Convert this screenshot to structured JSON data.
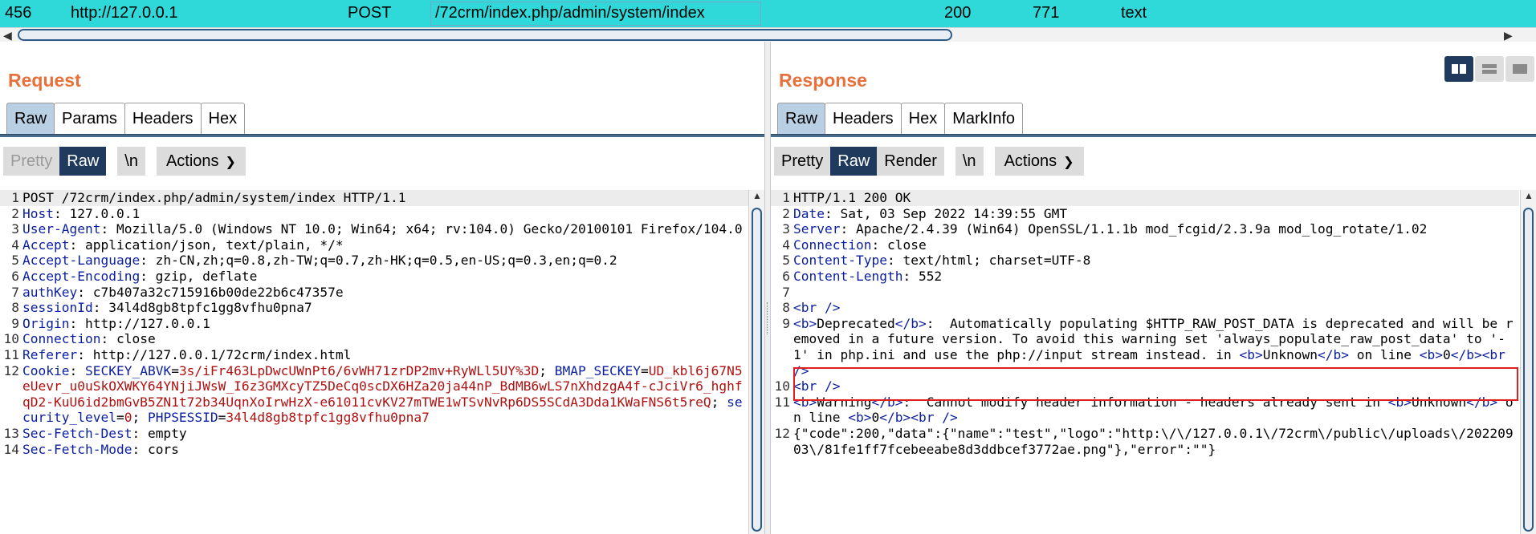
{
  "history_row": {
    "id": "456",
    "host": "http://127.0.0.1",
    "method": "POST",
    "path": "/72crm/index.php/admin/system/index",
    "status": "200",
    "length": "771",
    "mime": "text"
  },
  "request": {
    "title": "Request",
    "tabs": [
      "Raw",
      "Params",
      "Headers",
      "Hex"
    ],
    "toolbar": {
      "pretty": "Pretty",
      "raw": "Raw",
      "newline": "\\n",
      "actions": "Actions"
    },
    "lines": [
      {
        "n": "1",
        "parts": [
          {
            "t": "POST /72crm/index.php/admin/system/index HTTP/1.1",
            "c": ""
          }
        ]
      },
      {
        "n": "2",
        "parts": [
          {
            "t": "Host",
            "c": "hk"
          },
          {
            "t": ": 127.0.0.1",
            "c": ""
          }
        ]
      },
      {
        "n": "3",
        "parts": [
          {
            "t": "User-Agent",
            "c": "hk"
          },
          {
            "t": ": Mozilla/5.0 (Windows NT 10.0; Win64; x64; rv:104.0) Gecko/20100101 Firefox/104.0",
            "c": ""
          }
        ]
      },
      {
        "n": "4",
        "parts": [
          {
            "t": "Accept",
            "c": "hk"
          },
          {
            "t": ": application/json, text/plain, */*",
            "c": ""
          }
        ]
      },
      {
        "n": "5",
        "parts": [
          {
            "t": "Accept-Language",
            "c": "hk"
          },
          {
            "t": ": zh-CN,zh;q=0.8,zh-TW;q=0.7,zh-HK;q=0.5,en-US;q=0.3,en;q=0.2",
            "c": ""
          }
        ]
      },
      {
        "n": "6",
        "parts": [
          {
            "t": "Accept-Encoding",
            "c": "hk"
          },
          {
            "t": ": gzip, deflate",
            "c": ""
          }
        ]
      },
      {
        "n": "7",
        "parts": [
          {
            "t": "authKey",
            "c": "hk"
          },
          {
            "t": ": c7b407a32c715916b00de22b6c47357e",
            "c": ""
          }
        ]
      },
      {
        "n": "8",
        "parts": [
          {
            "t": "sessionId",
            "c": "hk"
          },
          {
            "t": ": 34l4d8gb8tpfc1gg8vfhu0pna7",
            "c": ""
          }
        ]
      },
      {
        "n": "9",
        "parts": [
          {
            "t": "Origin",
            "c": "hk"
          },
          {
            "t": ": http://127.0.0.1",
            "c": ""
          }
        ]
      },
      {
        "n": "10",
        "parts": [
          {
            "t": "Connection",
            "c": "hk"
          },
          {
            "t": ": close",
            "c": ""
          }
        ]
      },
      {
        "n": "11",
        "parts": [
          {
            "t": "Referer",
            "c": "hk"
          },
          {
            "t": ": http://127.0.0.1/72crm/index.html",
            "c": ""
          }
        ]
      },
      {
        "n": "12",
        "parts": [
          {
            "t": "Cookie",
            "c": "hk"
          },
          {
            "t": ": ",
            "c": ""
          },
          {
            "t": "SECKEY_ABVK",
            "c": "cn"
          },
          {
            "t": "=",
            "c": ""
          },
          {
            "t": "3s/iFr463LpDwcUWnPt6/6vWH71zrDP2mv+RyWLl5UY%3D",
            "c": "cv"
          },
          {
            "t": "; ",
            "c": ""
          },
          {
            "t": "BMAP_SECKEY",
            "c": "cn"
          },
          {
            "t": "=",
            "c": ""
          },
          {
            "t": "UD_kbl6j67N5eUevr_u0uSkOXWKY64YNjiJWsW_I6z3GMXcyTZ5DeCq0scDX6HZa20ja44nP_BdMB6wLS7nXhdzgA4f-cJciVr6_hghfqD2-KuU6id2bmGvB5ZN1t72b34UqnXoIrwHzX-e61011cvKV27mTWE1wTSvNvRp6DS5SCdA3Dda1KWaFNS6t5reQ",
            "c": "cv"
          },
          {
            "t": "; ",
            "c": ""
          },
          {
            "t": "security_level",
            "c": "cn"
          },
          {
            "t": "=",
            "c": ""
          },
          {
            "t": "0",
            "c": "cv"
          },
          {
            "t": "; ",
            "c": ""
          },
          {
            "t": "PHPSESSID",
            "c": "cn"
          },
          {
            "t": "=",
            "c": ""
          },
          {
            "t": "34l4d8gb8tpfc1gg8vfhu0pna7",
            "c": "cv"
          }
        ]
      },
      {
        "n": "13",
        "parts": [
          {
            "t": "Sec-Fetch-Dest",
            "c": "hk"
          },
          {
            "t": ": empty",
            "c": ""
          }
        ]
      },
      {
        "n": "14",
        "parts": [
          {
            "t": "Sec-Fetch-Mode",
            "c": "hk"
          },
          {
            "t": ": cors",
            "c": ""
          }
        ]
      }
    ]
  },
  "response": {
    "title": "Response",
    "tabs": [
      "Raw",
      "Headers",
      "Hex",
      "MarkInfo"
    ],
    "toolbar": {
      "pretty": "Pretty",
      "raw": "Raw",
      "render": "Render",
      "newline": "\\n",
      "actions": "Actions"
    },
    "lines": [
      {
        "n": "1",
        "parts": [
          {
            "t": "HTTP/1.1 200 OK",
            "c": ""
          }
        ]
      },
      {
        "n": "2",
        "parts": [
          {
            "t": "Date",
            "c": "hk"
          },
          {
            "t": ": Sat, 03 Sep 2022 14:39:55 GMT",
            "c": ""
          }
        ]
      },
      {
        "n": "3",
        "parts": [
          {
            "t": "Server",
            "c": "hk"
          },
          {
            "t": ": Apache/2.4.39 (Win64) OpenSSL/1.1.1b mod_fcgid/2.3.9a mod_log_rotate/1.02",
            "c": ""
          }
        ]
      },
      {
        "n": "4",
        "parts": [
          {
            "t": "Connection",
            "c": "hk"
          },
          {
            "t": ": close",
            "c": ""
          }
        ]
      },
      {
        "n": "5",
        "parts": [
          {
            "t": "Content-Type",
            "c": "hk"
          },
          {
            "t": ": text/html; charset=UTF-8",
            "c": ""
          }
        ]
      },
      {
        "n": "6",
        "parts": [
          {
            "t": "Content-Length",
            "c": "hk"
          },
          {
            "t": ": 552",
            "c": ""
          }
        ]
      },
      {
        "n": "7",
        "parts": [
          {
            "t": "",
            "c": ""
          }
        ]
      },
      {
        "n": "8",
        "parts": [
          {
            "t": "<br />",
            "c": "hk"
          }
        ]
      },
      {
        "n": "9",
        "parts": [
          {
            "t": "<b>",
            "c": "hk"
          },
          {
            "t": "Deprecated",
            "c": ""
          },
          {
            "t": "</b>",
            "c": "hk"
          },
          {
            "t": ":  Automatically populating $HTTP_RAW_POST_DATA is deprecated and will be removed in a future version. To avoid this warning set 'always_populate_raw_post_data' to '-1' in php.ini and use the php://input stream instead. in ",
            "c": ""
          },
          {
            "t": "<b>",
            "c": "hk"
          },
          {
            "t": "Unknown",
            "c": ""
          },
          {
            "t": "</b>",
            "c": "hk"
          },
          {
            "t": " on line ",
            "c": ""
          },
          {
            "t": "<b>",
            "c": "hk"
          },
          {
            "t": "0",
            "c": ""
          },
          {
            "t": "</b>",
            "c": "hk"
          },
          {
            "t": "<br />",
            "c": "hk"
          }
        ]
      },
      {
        "n": "10",
        "parts": [
          {
            "t": "<br />",
            "c": "hk"
          }
        ]
      },
      {
        "n": "11",
        "parts": [
          {
            "t": "<b>",
            "c": "hk"
          },
          {
            "t": "Warning",
            "c": ""
          },
          {
            "t": "</b>",
            "c": "hk"
          },
          {
            "t": ":  Cannot modify header information - headers already sent in ",
            "c": ""
          },
          {
            "t": "<b>",
            "c": "hk"
          },
          {
            "t": "Unknown",
            "c": ""
          },
          {
            "t": "</b>",
            "c": "hk"
          },
          {
            "t": " on line ",
            "c": ""
          },
          {
            "t": "<b>",
            "c": "hk"
          },
          {
            "t": "0",
            "c": ""
          },
          {
            "t": "</b>",
            "c": "hk"
          },
          {
            "t": "<br />",
            "c": "hk"
          }
        ]
      },
      {
        "n": "12",
        "parts": [
          {
            "t": "{\"code\":200,\"data\":{\"name\":\"test\",\"logo\":\"http:\\/\\/127.0.0.1\\/72crm\\/public\\/uploads\\/20220903\\/81fe1ff7fcebeeabe8d3ddbcef3772ae.png\"},\"error\":\"\"}",
            "c": ""
          }
        ]
      }
    ]
  },
  "colors": {
    "accent_title": "#e8703a",
    "selected_row": "#30d9d9",
    "highlight_box": "#e02020",
    "header_key": "#0a1ea0",
    "cookie_value": "#b01010"
  }
}
